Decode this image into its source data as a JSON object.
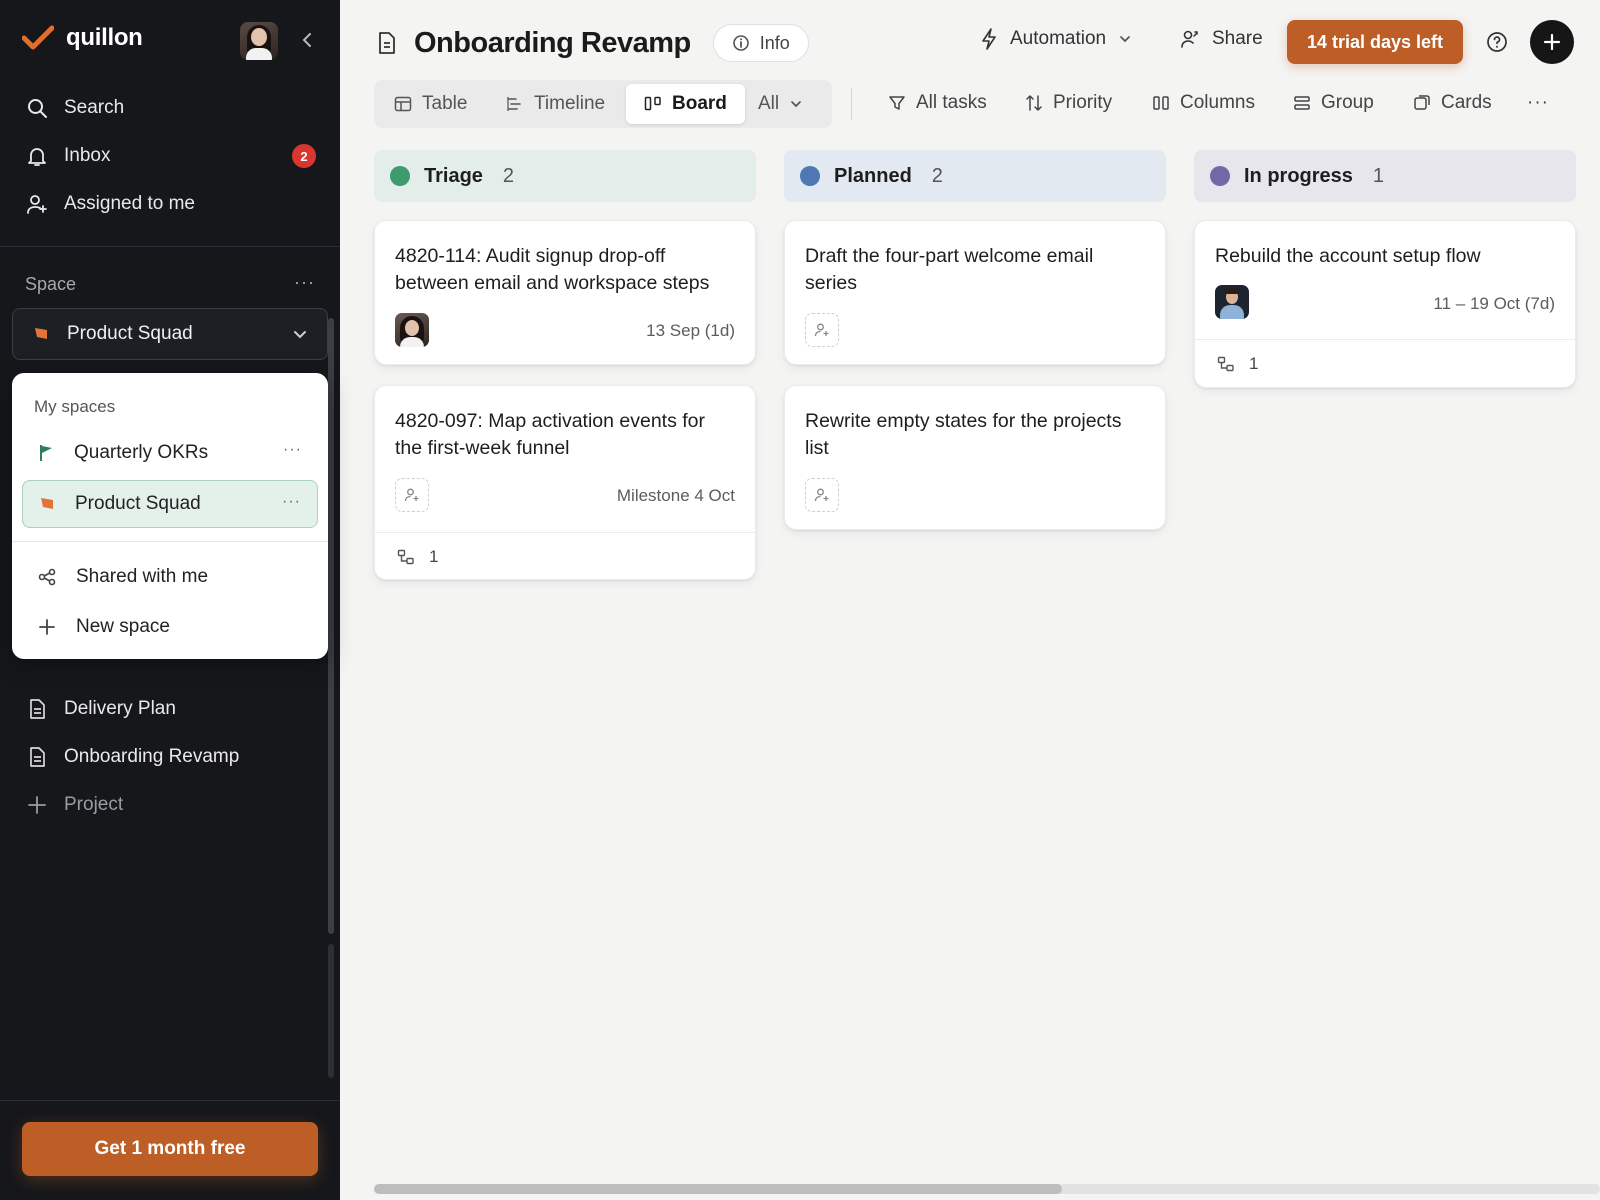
{
  "sidebar": {
    "brand": "quillon",
    "nav": [
      {
        "label": "Search"
      },
      {
        "label": "Inbox",
        "badge": "2"
      },
      {
        "label": "Assigned to me"
      }
    ],
    "space_label": "Space",
    "space_selected": "Product Squad",
    "dropdown": {
      "heading": "My spaces",
      "items": [
        {
          "label": "Quarterly OKRs",
          "icon": "green-flag-icon"
        },
        {
          "label": "Product Squad",
          "icon": "orange-flag-icon",
          "active": true
        }
      ],
      "actions": [
        {
          "label": "Shared with me"
        },
        {
          "label": "New space"
        }
      ]
    },
    "projects": [
      {
        "label": "Delivery Plan"
      },
      {
        "label": "Onboarding Revamp"
      }
    ],
    "add_project_label": "Project",
    "cta_label": "Get 1 month free"
  },
  "header": {
    "title": "Onboarding Revamp",
    "info_label": "Info",
    "automation_label": "Automation",
    "share_label": "Share",
    "trial_label": "14 trial days left"
  },
  "views": {
    "tabs": [
      {
        "label": "Table"
      },
      {
        "label": "Timeline"
      },
      {
        "label": "Board",
        "active": true
      }
    ],
    "filter_label": "All"
  },
  "toolbar": {
    "all_tasks": "All tasks",
    "priority": "Priority",
    "columns": "Columns",
    "group": "Group",
    "cards": "Cards"
  },
  "board": {
    "columns": [
      {
        "name": "Triage",
        "count": "2",
        "color": "#3f9a6e",
        "bg": "#e3eeea",
        "cards": [
          {
            "title": "4820-114: Audit signup drop-off between email and workspace steps",
            "meta": "13 Sep (1d)"
          },
          {
            "title": "4820-097: Map activation events for the first-week funnel",
            "meta": "Milestone 4 Oct",
            "subtasks": "1"
          }
        ]
      },
      {
        "name": "Planned",
        "count": "2",
        "color": "#4d78b4",
        "bg": "#e2e9f1",
        "cards": [
          {
            "title": "Draft the four-part welcome email series"
          },
          {
            "title": "Rewrite empty states for the projects list"
          }
        ]
      },
      {
        "name": "In progress",
        "count": "1",
        "color": "#7468a8",
        "bg": "#e6e6ec",
        "cards": [
          {
            "title": "Rebuild the account setup flow",
            "meta": "11 – 19 Oct (7d)",
            "subtasks": "1"
          }
        ]
      }
    ]
  },
  "colors": {
    "accent": "#bd5e26",
    "sidebar_bg": "#15171b"
  }
}
